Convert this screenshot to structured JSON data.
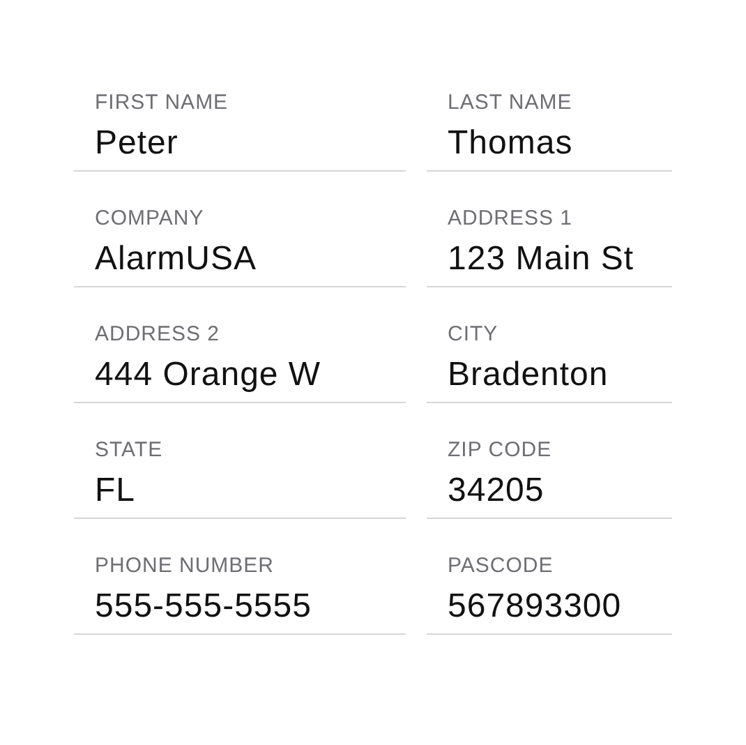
{
  "fields": [
    {
      "label": "FIRST NAME",
      "value": "Peter"
    },
    {
      "label": "LAST NAME",
      "value": "Thomas"
    },
    {
      "label": "COMPANY",
      "value": "AlarmUSA"
    },
    {
      "label": "ADDRESS 1",
      "value": "123 Main St"
    },
    {
      "label": "ADDRESS 2",
      "value": "444 Orange W"
    },
    {
      "label": "CITY",
      "value": "Bradenton"
    },
    {
      "label": "STATE",
      "value": "FL"
    },
    {
      "label": "ZIP CODE",
      "value": "34205"
    },
    {
      "label": "PHONE NUMBER",
      "value": "555-555-5555"
    },
    {
      "label": "PASCODE",
      "value": "567893300"
    }
  ]
}
